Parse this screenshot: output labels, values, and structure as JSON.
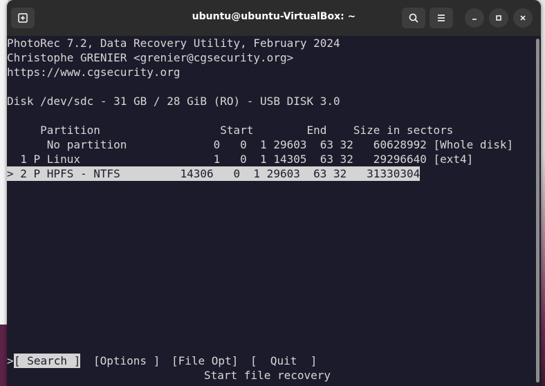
{
  "window": {
    "title": "ubuntu@ubuntu-VirtualBox: ~",
    "icons": {
      "new_tab": "new-tab-icon",
      "search": "search-icon",
      "menu": "hamburger-menu-icon",
      "minimize": "minimize-icon",
      "maximize": "maximize-icon",
      "close": "close-icon"
    }
  },
  "header": {
    "line1": "PhotoRec 7.2, Data Recovery Utility, February 2024",
    "line2": "Christophe GRENIER <grenier@cgsecurity.org>",
    "line3": "https://www.cgsecurity.org"
  },
  "disk": "Disk /dev/sdc - 31 GB / 28 GiB (RO) - USB DISK 3.0",
  "table": {
    "header": "     Partition                  Start        End    Size in sectors",
    "rows": [
      {
        "text": "      No partition             0   0  1 29603  63 32   60628992 [Whole disk]",
        "selected": false
      },
      {
        "text": "  1 P Linux                    1   0  1 14305  63 32   29296640 [ext4]",
        "selected": false
      },
      {
        "text": "> 2 P HPFS - NTFS         14306   0  1 29603  63 32   31330304",
        "selected": true
      }
    ]
  },
  "menu": {
    "prefix": ">",
    "search": "[ Search ]",
    "options": "[Options ]",
    "file_opt": "[File Opt]",
    "quit": "[  Quit  ]"
  },
  "hint": "Start file recovery",
  "colors": {
    "terminal_bg": "#1c1b2b",
    "text": "#d7d7d7",
    "highlight_bg": "#d4d4d4"
  }
}
